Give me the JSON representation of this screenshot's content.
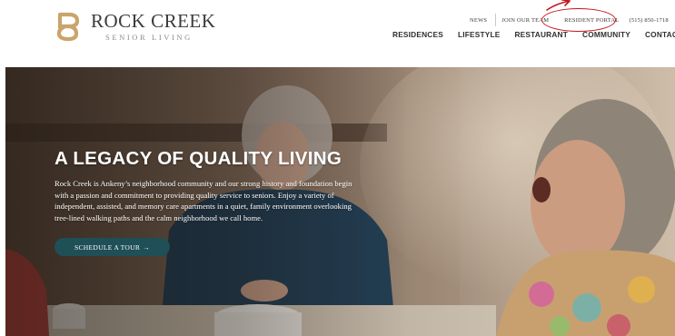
{
  "brand": {
    "name": "ROCK CREEK",
    "tagline": "SENIOR LIVING",
    "colors": {
      "logo_gold": "#c9a46b",
      "annotation_red": "#c4141e",
      "button_teal": "#1f4f57"
    }
  },
  "utility_nav": {
    "news": "NEWS",
    "join": "JOIN OUR TEAM",
    "portal": "RESIDENT PORTAL",
    "phone": "(515) 850-1718"
  },
  "main_nav": {
    "items": [
      "RESIDENCES",
      "LIFESTYLE",
      "RESTAURANT",
      "COMMUNITY",
      "CONTACT"
    ]
  },
  "hero": {
    "title": "A LEGACY OF QUALITY LIVING",
    "body": "Rock Creek is Ankeny’s neighborhood community and our strong history and foundation begin with a passion and commitment to providing quality service to seniors. Enjoy a variety of independent, assisted, and memory care apartments in a quiet, family environment overlooking tree-lined walking paths and the calm neighborhood we call home.",
    "cta_label": "SCHEDULE A TOUR",
    "cta_arrow": "→"
  },
  "icons": {
    "logo": "rock-creek-r-logo",
    "annotation": "red-circle-highlight-with-arrow"
  }
}
